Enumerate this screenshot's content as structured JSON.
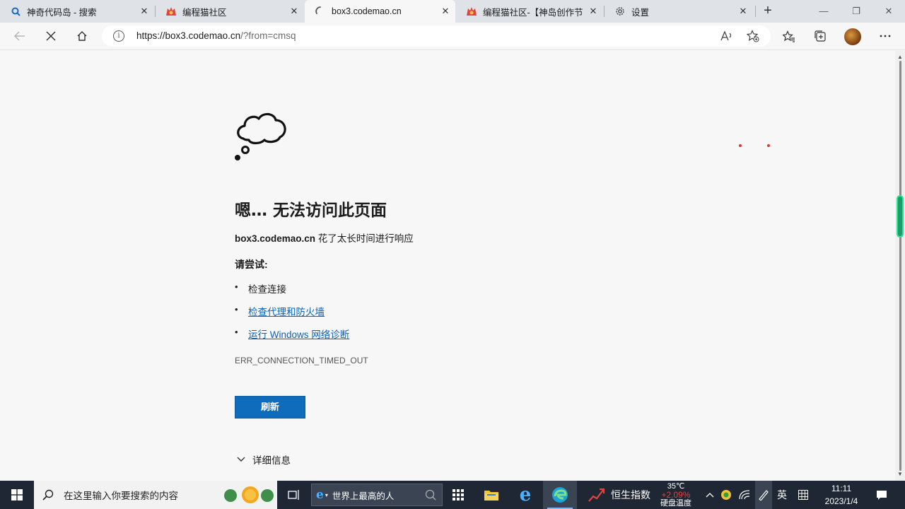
{
  "browser": {
    "tabs": [
      {
        "title": "神奇代码岛 - 搜索",
        "icon": "search-favicon"
      },
      {
        "title": "编程猫社区",
        "icon": "codemao-favicon"
      },
      {
        "title": "box3.codemao.cn",
        "icon": "loading-favicon",
        "active": true
      },
      {
        "title": "编程猫社区-【神岛创作节】",
        "icon": "codemao-favicon"
      },
      {
        "title": "设置",
        "icon": "gear-icon"
      }
    ],
    "close_glyph": "✕",
    "new_tab_glyph": "+",
    "window_controls": {
      "minimize": "—",
      "restore": "❐",
      "close": "✕"
    },
    "address": {
      "url_main": "https://box3.codemao.cn",
      "url_rest": "/?from=cmsq",
      "info_glyph": "i"
    }
  },
  "error_page": {
    "heading": "嗯… 无法访问此页面",
    "host": "box3.codemao.cn",
    "message": " 花了太长时间进行响应",
    "try_label": "请尝试:",
    "tips": [
      {
        "text": "检查连接",
        "link": false
      },
      {
        "text": "检查代理和防火墙",
        "link": true
      },
      {
        "text": "运行 Windows 网络诊断",
        "link": true
      }
    ],
    "error_code": "ERR_CONNECTION_TIMED_OUT",
    "refresh_label": "刷新",
    "details_label": "详细信息"
  },
  "taskbar": {
    "search_placeholder": "在这里输入你要搜索的内容",
    "ie_text": "世界上最高的人",
    "stock_label": "恒生指数",
    "stock_change": "+2.09%",
    "temp": "35℃",
    "temp_label": "硬盘温度",
    "ime": "英",
    "time": "11:11",
    "date": "2023/1/4"
  },
  "colors": {
    "accent": "#0f6cbd",
    "link": "#0b62b3",
    "taskbar": "#1e2733",
    "stock_red": "#e0443c"
  }
}
